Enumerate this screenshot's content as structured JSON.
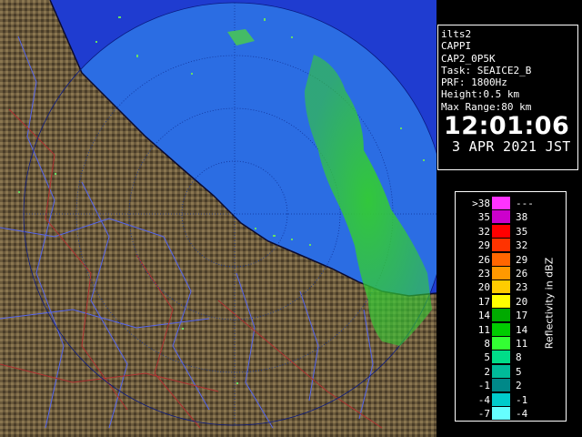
{
  "station": {
    "lines": [
      "ilts2",
      "CAPPI",
      "CAP2_0P5K",
      "Task: SEAICE2_B",
      "PRF: 1800Hz",
      "Height:0.5 km",
      "Max Range:80 km"
    ],
    "time": "12:01:06",
    "date": "3 APR 2021 JST"
  },
  "legend": {
    "title": "Reflectivity in dBZ",
    "rows": [
      {
        "lo": ">38",
        "hi": "---",
        "color": "#ff33ff"
      },
      {
        "lo": "35",
        "hi": "38",
        "color": "#cc00cc"
      },
      {
        "lo": "32",
        "hi": "35",
        "color": "#ff0000"
      },
      {
        "lo": "29",
        "hi": "32",
        "color": "#ff3300"
      },
      {
        "lo": "26",
        "hi": "29",
        "color": "#ff6600"
      },
      {
        "lo": "23",
        "hi": "26",
        "color": "#ff9900"
      },
      {
        "lo": "20",
        "hi": "23",
        "color": "#ffcc00"
      },
      {
        "lo": "17",
        "hi": "20",
        "color": "#ffff00"
      },
      {
        "lo": "14",
        "hi": "17",
        "color": "#00aa00"
      },
      {
        "lo": "11",
        "hi": "14",
        "color": "#00cc00"
      },
      {
        "lo": "8",
        "hi": "11",
        "color": "#33ff33"
      },
      {
        "lo": "5",
        "hi": "8",
        "color": "#00dd88"
      },
      {
        "lo": "2",
        "hi": "5",
        "color": "#00bb99"
      },
      {
        "lo": "-1",
        "hi": "2",
        "color": "#008888"
      },
      {
        "lo": "-4",
        "hi": "-1",
        "color": "#00cccc"
      },
      {
        "lo": "-7",
        "hi": "-4",
        "color": "#66ffff"
      }
    ]
  },
  "colors": {
    "sea": "#2b6de3",
    "outer": "#1f3cd0",
    "land": "#6b5a3c",
    "echo": "#33cc33"
  }
}
